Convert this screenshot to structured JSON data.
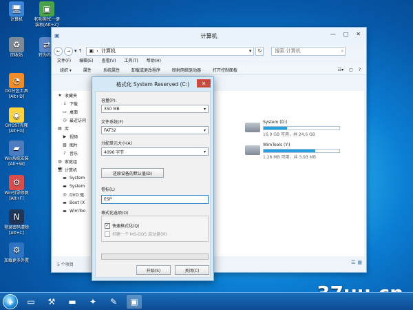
{
  "desktop": {
    "icons": [
      {
        "label": "计算机",
        "sub": "",
        "icon": "computer-icon"
      },
      {
        "label": "老毛桃PE一键",
        "sub": "装机[Alt+Z]",
        "icon": "installer-icon"
      },
      {
        "label": "回收站",
        "sub": "",
        "icon": "recycle-bin-icon"
      },
      {
        "label": "转为内置",
        "sub": "",
        "icon": "convert-icon"
      },
      {
        "label": "DG分区工具",
        "sub": "[Alt+D]",
        "icon": "partition-icon"
      },
      {
        "label": "GHOST克隆",
        "sub": "[Alt+G]",
        "icon": "ghost-icon"
      },
      {
        "label": "Win系统安装",
        "sub": "[Alt+W]",
        "icon": "win-installer-icon"
      },
      {
        "label": "Win引导修复",
        "sub": "[Alt+F]",
        "icon": "boot-repair-icon"
      },
      {
        "label": "登录密码清除",
        "sub": "[Alt+C]",
        "icon": "password-clear-icon"
      },
      {
        "label": "加载更多外置",
        "sub": "",
        "icon": "load-more-icon"
      }
    ],
    "watermark": "37uu.cn"
  },
  "taskbar": {
    "items": [
      "start-orb-icon",
      "folder-icon",
      "tools-icon",
      "drive-icon",
      "apps-icon",
      "notepad-icon",
      "explorer-icon"
    ]
  },
  "explorer": {
    "title": "计算机",
    "address": "计算机",
    "search_placeholder": "搜索 计算机",
    "menus": [
      "文件(F)",
      "编辑(E)",
      "查看(V)",
      "工具(T)",
      "帮助(H)"
    ],
    "toolbar": [
      "组织 ▾",
      "属性",
      "系统属性",
      "卸载或更改程序",
      "映射网络驱动器",
      "打开控制面板"
    ],
    "tree": [
      {
        "label": "收藏夹",
        "sub": false,
        "icon": "star-icon"
      },
      {
        "label": "下载",
        "sub": true,
        "icon": "download-icon"
      },
      {
        "label": "桌面",
        "sub": true,
        "icon": "desktop-icon"
      },
      {
        "label": "最近访问",
        "sub": true,
        "icon": "recent-icon"
      },
      {
        "label": "库",
        "sub": false,
        "icon": "library-icon"
      },
      {
        "label": "视频",
        "sub": true,
        "icon": "video-icon"
      },
      {
        "label": "图片",
        "sub": true,
        "icon": "picture-icon"
      },
      {
        "label": "音乐",
        "sub": true,
        "icon": "music-icon"
      },
      {
        "label": "家庭组",
        "sub": false,
        "icon": "homegroup-icon"
      },
      {
        "label": "计算机",
        "sub": false,
        "icon": "computer-icon"
      },
      {
        "label": "System",
        "sub": true,
        "icon": "drive-icon"
      },
      {
        "label": "System",
        "sub": true,
        "icon": "drive-icon"
      },
      {
        "label": "DVD 驱",
        "sub": true,
        "icon": "dvd-icon"
      },
      {
        "label": "Boot (X",
        "sub": true,
        "icon": "drive-icon"
      },
      {
        "label": "WimToo",
        "sub": true,
        "icon": "drive-icon"
      }
    ],
    "drives": [
      {
        "name": "System (D:)",
        "free": "16.9 GB 可用，共 24.6 GB",
        "usage": 0.31
      },
      {
        "name": "WimTools (Y:)",
        "free": "1.26 MB 可用，共 3.93 MB",
        "usage": 0.68
      }
    ],
    "status": "5 个项目"
  },
  "dialog": {
    "title": "格式化 System Reserved (C:)",
    "capacity_label": "容量(P):",
    "capacity_value": "350 MB",
    "fs_label": "文件系统(F)",
    "fs_value": "FAT32",
    "unit_label": "分配单元大小(A)",
    "unit_value": "4096 字节",
    "restore_button": "还原设备的默认值(D)",
    "volume_label": "卷标(L)",
    "volume_value": "ESP",
    "options_label": "格式化选项(O)",
    "quick_format": "快速格式化(Q)",
    "msdos_disk": "创建一个 MS-DOS 启动盘(M)",
    "start_button": "开始(S)",
    "close_button": "关闭(C)"
  }
}
